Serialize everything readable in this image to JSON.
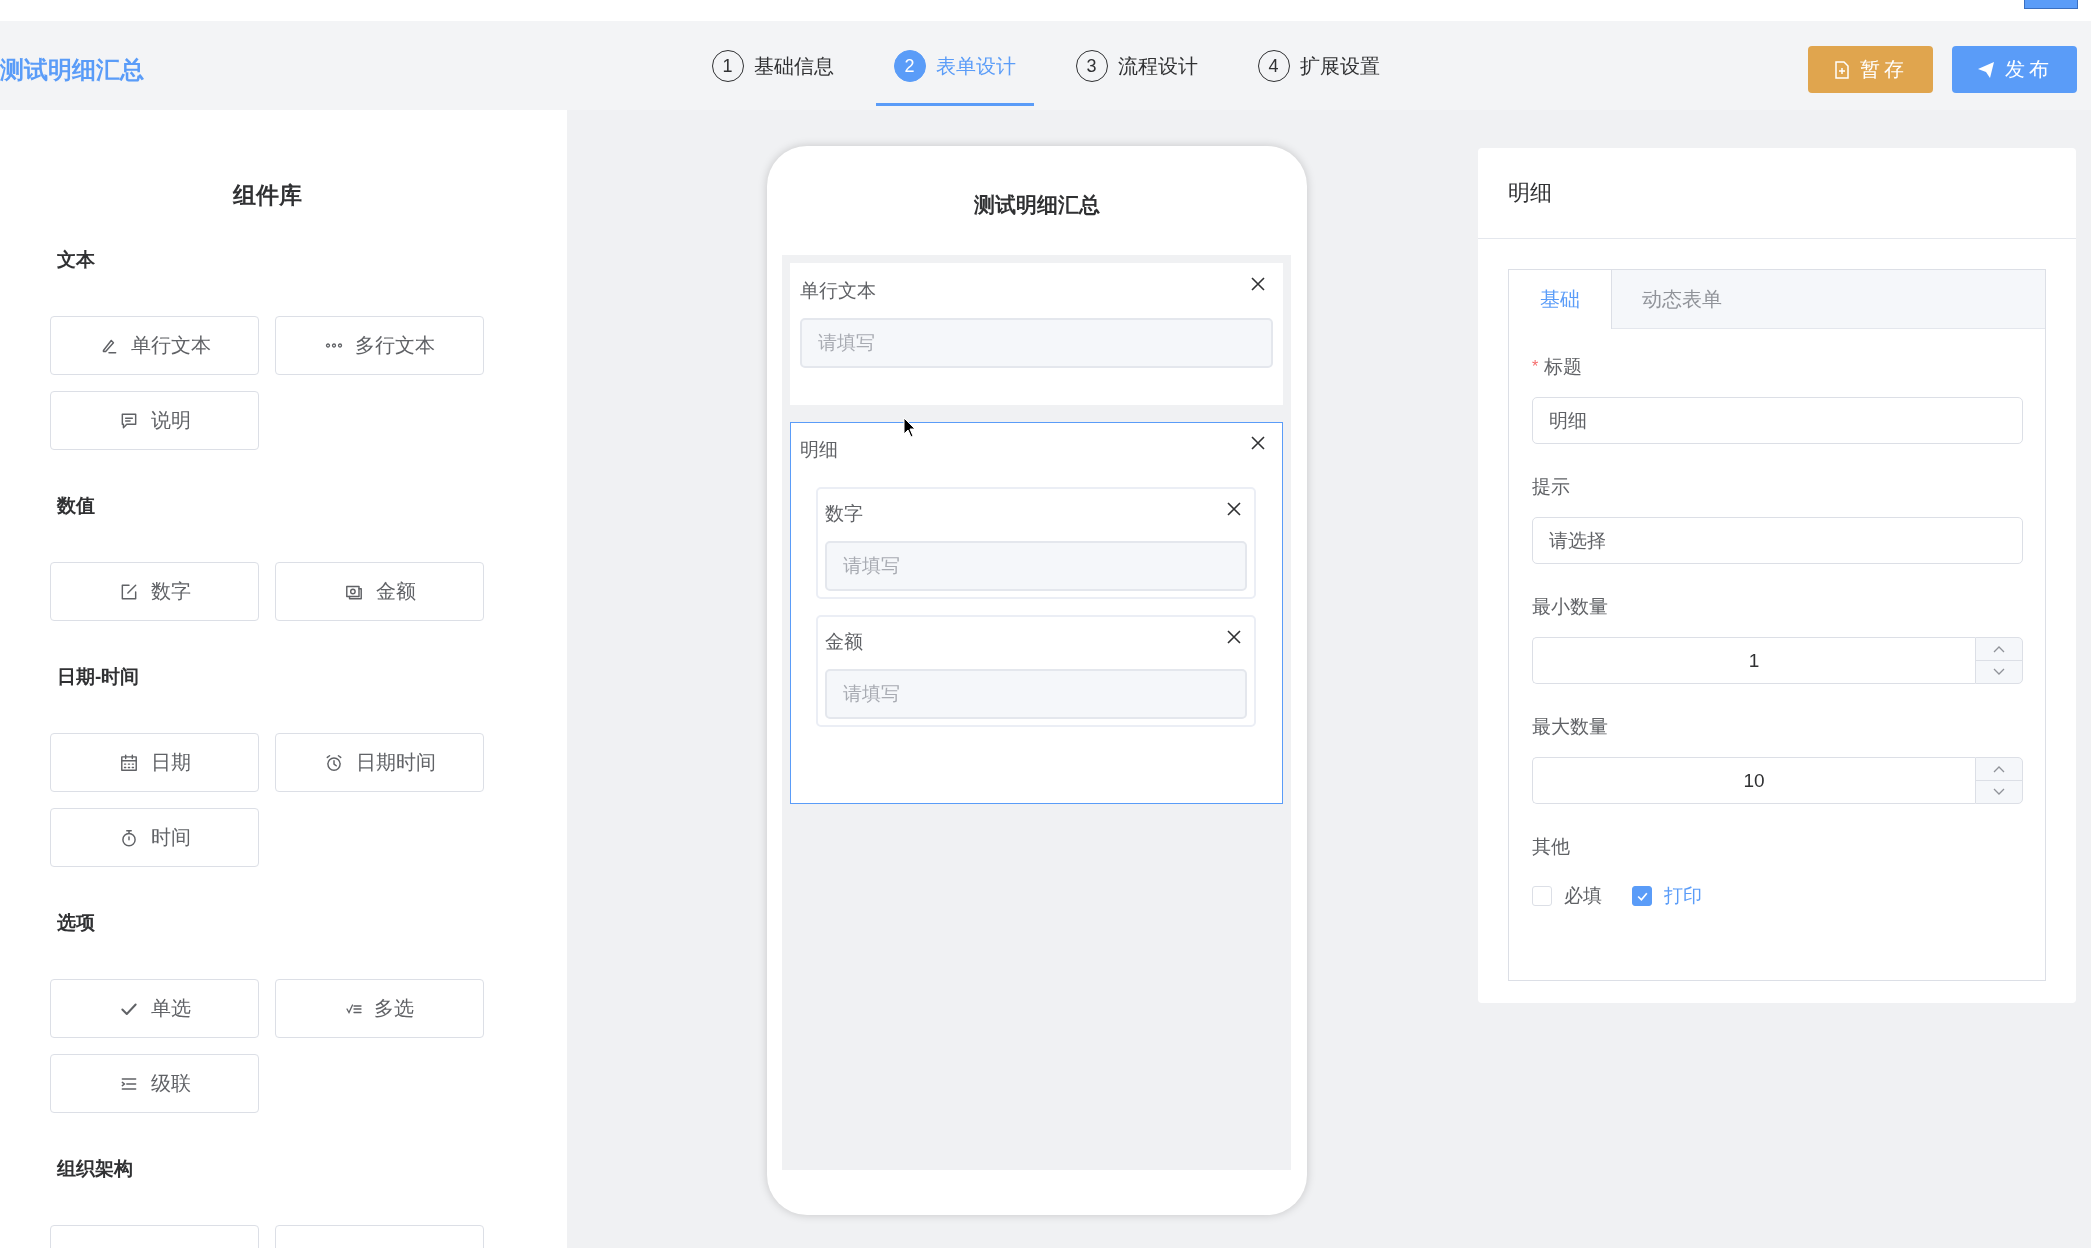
{
  "header": {
    "title": "测试明细汇总",
    "steps": [
      {
        "number": "1",
        "label": "基础信息",
        "selected": false
      },
      {
        "number": "2",
        "label": "表单设计",
        "selected": true
      },
      {
        "number": "3",
        "label": "流程设计",
        "selected": false
      },
      {
        "number": "4",
        "label": "扩展设置",
        "selected": false
      }
    ],
    "buttons": [
      {
        "kind": "save",
        "label": "暂存"
      },
      {
        "kind": "publish",
        "label": "发布"
      }
    ]
  },
  "library": {
    "title": "组件库",
    "sections": [
      {
        "title": "文本",
        "items": [
          {
            "kind": "single-line",
            "label": "单行文本"
          },
          {
            "kind": "multi-line",
            "label": "多行文本"
          },
          {
            "kind": "note",
            "label": "说明"
          }
        ]
      },
      {
        "title": "数值",
        "items": [
          {
            "kind": "number",
            "label": "数字"
          },
          {
            "kind": "amount",
            "label": "金额"
          }
        ]
      },
      {
        "title": "日期-时间",
        "items": [
          {
            "kind": "date",
            "label": "日期"
          },
          {
            "kind": "datetime",
            "label": "日期时间"
          },
          {
            "kind": "time",
            "label": "时间"
          }
        ]
      },
      {
        "title": "选项",
        "items": [
          {
            "kind": "single-choice",
            "label": "单选"
          },
          {
            "kind": "multi-choice",
            "label": "多选"
          },
          {
            "kind": "cascade",
            "label": "级联"
          }
        ]
      },
      {
        "title": "组织架构",
        "items": [
          {
            "kind": "cut"
          },
          {
            "kind": "cut"
          }
        ]
      }
    ]
  },
  "phone": {
    "title": "测试明细汇总",
    "fields": [
      {
        "kind": "input",
        "label": "单行文本",
        "placeholder": "请填写",
        "selected": false
      },
      {
        "kind": "group",
        "label": "明细",
        "selected": true,
        "children": [
          {
            "kind": "input",
            "label": "数字",
            "placeholder": "请填写"
          },
          {
            "kind": "input",
            "label": "金额",
            "placeholder": "请填写"
          }
        ]
      }
    ]
  },
  "properties": {
    "title": "明细",
    "tabs": [
      {
        "label": "基础",
        "selected": true
      },
      {
        "label": "动态表单",
        "selected": false
      }
    ],
    "fields": [
      {
        "kind": "text",
        "label": "标题",
        "required_mark": "*",
        "value": "明细"
      },
      {
        "kind": "text",
        "label": "提示",
        "value": "请选择"
      },
      {
        "kind": "number",
        "label": "最小数量",
        "value": "1"
      },
      {
        "kind": "number",
        "label": "最大数量",
        "value": "10"
      },
      {
        "kind": "checkboxes",
        "label": "其他",
        "options": [
          {
            "label": "必填",
            "checked": false
          },
          {
            "label": "打印",
            "checked": true
          }
        ]
      }
    ]
  }
}
